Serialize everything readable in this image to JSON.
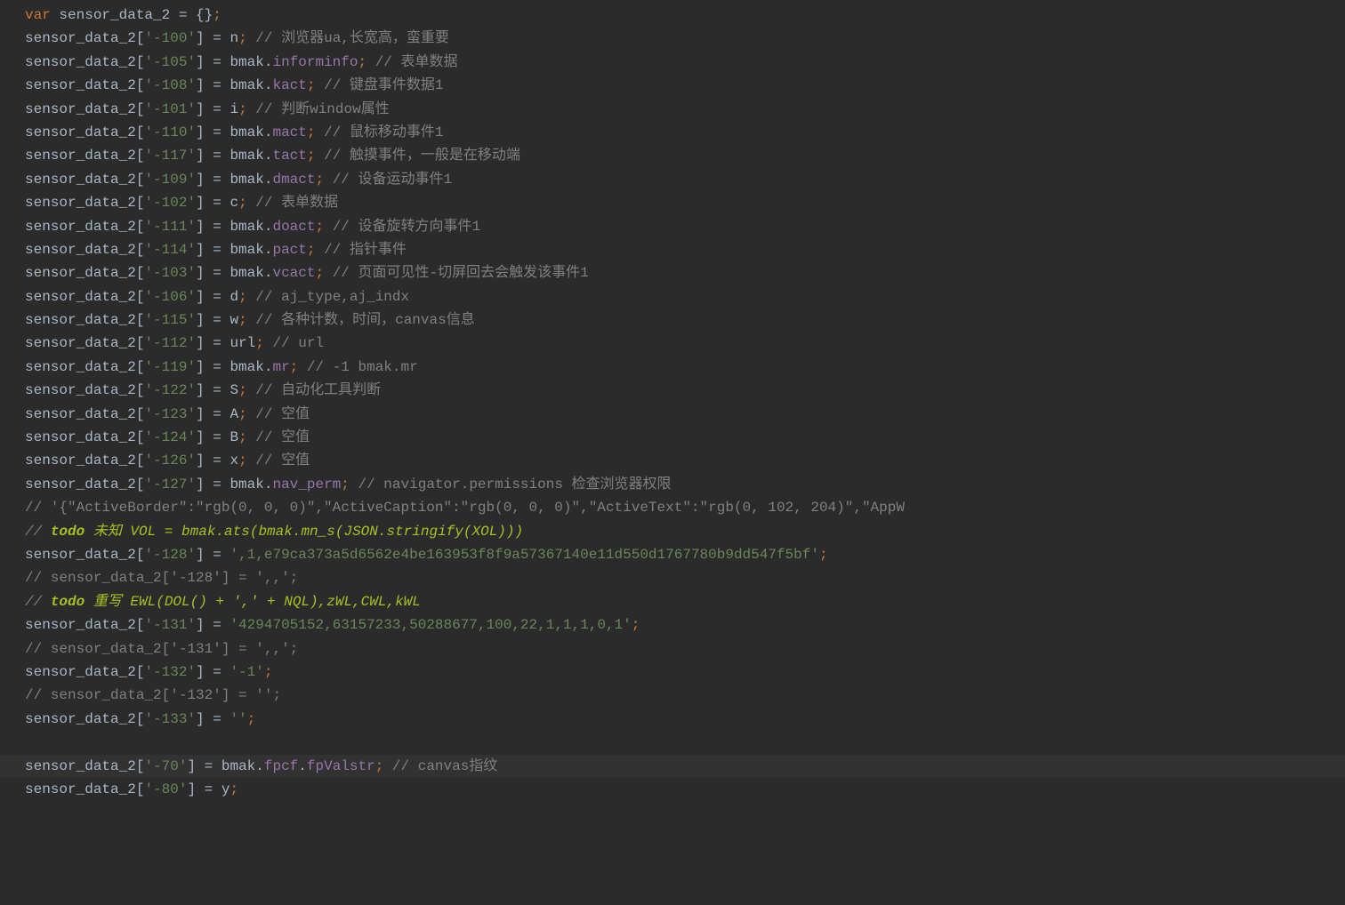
{
  "lines": [
    {
      "text": "var sensor_data_2 = {};",
      "tokens": [
        [
          "keyword",
          "var "
        ],
        [
          "identifier",
          "sensor_data_2 "
        ],
        [
          "operator",
          "= "
        ],
        [
          "bracket",
          "{}"
        ],
        [
          "semicolon",
          ";"
        ]
      ]
    },
    {
      "key": "-100",
      "value": "n",
      "comment": "浏览器ua,长宽高，蛮重要"
    },
    {
      "key": "-105",
      "value": "bmak.informinfo",
      "comment": "表单数据",
      "prop": true
    },
    {
      "key": "-108",
      "value": "bmak.kact",
      "comment": "键盘事件数据1",
      "prop": true
    },
    {
      "key": "-101",
      "value": "i",
      "comment": "判断window属性"
    },
    {
      "key": "-110",
      "value": "bmak.mact",
      "comment": "鼠标移动事件1",
      "prop": true
    },
    {
      "key": "-117",
      "value": "bmak.tact",
      "comment": "触摸事件，一般是在移动端",
      "prop": true
    },
    {
      "key": "-109",
      "value": "bmak.dmact",
      "comment": "设备运动事件1",
      "prop": true
    },
    {
      "key": "-102",
      "value": "c",
      "comment": "表单数据"
    },
    {
      "key": "-111",
      "value": "bmak.doact",
      "comment": "设备旋转方向事件1",
      "prop": true
    },
    {
      "key": "-114",
      "value": "bmak.pact",
      "comment": "指针事件",
      "prop": true
    },
    {
      "key": "-103",
      "value": "bmak.vcact",
      "comment": "页面可见性-切屏回去会触发该事件1",
      "prop": true
    },
    {
      "key": "-106",
      "value": "d",
      "comment": "aj_type,aj_indx"
    },
    {
      "key": "-115",
      "value": "w",
      "comment": "各种计数，时间，canvas信息"
    },
    {
      "key": "-112",
      "value": "url",
      "comment": "url"
    },
    {
      "key": "-119",
      "value": "bmak.mr",
      "comment": "-1 bmak.mr",
      "prop": true
    },
    {
      "key": "-122",
      "value": "S",
      "comment": "自动化工具判断"
    },
    {
      "key": "-123",
      "value": "A",
      "comment": "空值"
    },
    {
      "key": "-124",
      "value": "B",
      "comment": "空值"
    },
    {
      "key": "-126",
      "value": "x",
      "comment": "空值"
    },
    {
      "key": "-127",
      "value": "bmak.nav_perm",
      "comment": "navigator.permissions 检查浏览器权限",
      "prop": true
    },
    {
      "type": "comment-line",
      "text": "// '{\"ActiveBorder\":\"rgb(0, 0, 0)\",\"ActiveCaption\":\"rgb(0, 0, 0)\",\"ActiveText\":\"rgb(0, 102, 204)\",\"AppW"
    },
    {
      "type": "todo-line",
      "prefix": "//  ",
      "todo": "todo",
      "rest": " 未知   VOL = bmak.ats(bmak.mn_s(JSON.stringify(XOL)))"
    },
    {
      "key": "-128",
      "strvalue": "',1,e79ca373a5d6562e4be163953f8f9a57367140e11d550d1767780b9dd547f5bf'"
    },
    {
      "type": "comment-line",
      "text": "//  sensor_data_2['-128'] = ',,';"
    },
    {
      "type": "todo-line",
      "prefix": "//  ",
      "todo": "todo",
      "rest": " 重写   EWL(DOL() + ',' + NQL),zWL,CWL,kWL"
    },
    {
      "key": "-131",
      "strvalue": "'4294705152,63157233,50288677,100,22,1,1,1,0,1'"
    },
    {
      "type": "comment-line",
      "text": "//  sensor_data_2['-131'] = ',,';"
    },
    {
      "key": "-132",
      "strvalue": "'-1'"
    },
    {
      "type": "comment-line",
      "text": "//  sensor_data_2['-132'] = '';"
    },
    {
      "key": "-133",
      "strvalue": "''"
    },
    {
      "type": "blank"
    },
    {
      "key": "-70",
      "value": "bmak.fpcf.fpValstr",
      "comment": "canvas指纹",
      "prop": true,
      "highlighted": true,
      "proppath": [
        "fpcf",
        "fpValstr"
      ]
    },
    {
      "key": "-80",
      "value": "y"
    }
  ],
  "var_name": "sensor_data_2",
  "bmak_name": "bmak"
}
